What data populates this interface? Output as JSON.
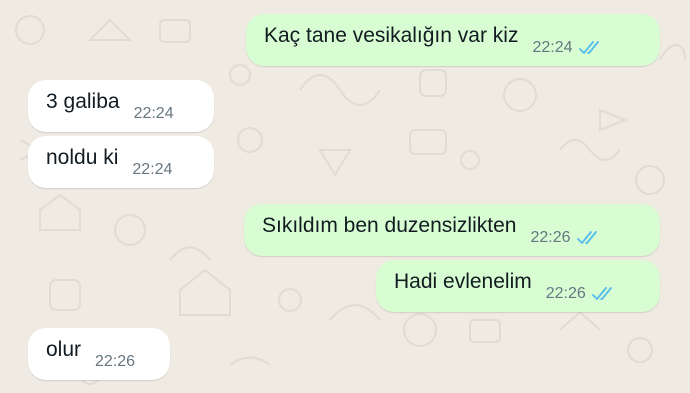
{
  "chat": {
    "accent_tick_color": "#53bdeb",
    "messages": [
      {
        "direction": "out",
        "text": "Kaç tane vesikalığın var kiz",
        "time": "22:24",
        "status": "read"
      },
      {
        "direction": "in",
        "text": "3 galiba",
        "time": "22:24"
      },
      {
        "direction": "in",
        "text": "noldu ki",
        "time": "22:24"
      },
      {
        "direction": "out",
        "text": "Sıkıldım ben duzensizlikten",
        "time": "22:26",
        "status": "read"
      },
      {
        "direction": "out",
        "text": "Hadi evlenelim",
        "time": "22:26",
        "status": "read"
      },
      {
        "direction": "in",
        "text": "olur",
        "time": "22:26"
      }
    ]
  }
}
